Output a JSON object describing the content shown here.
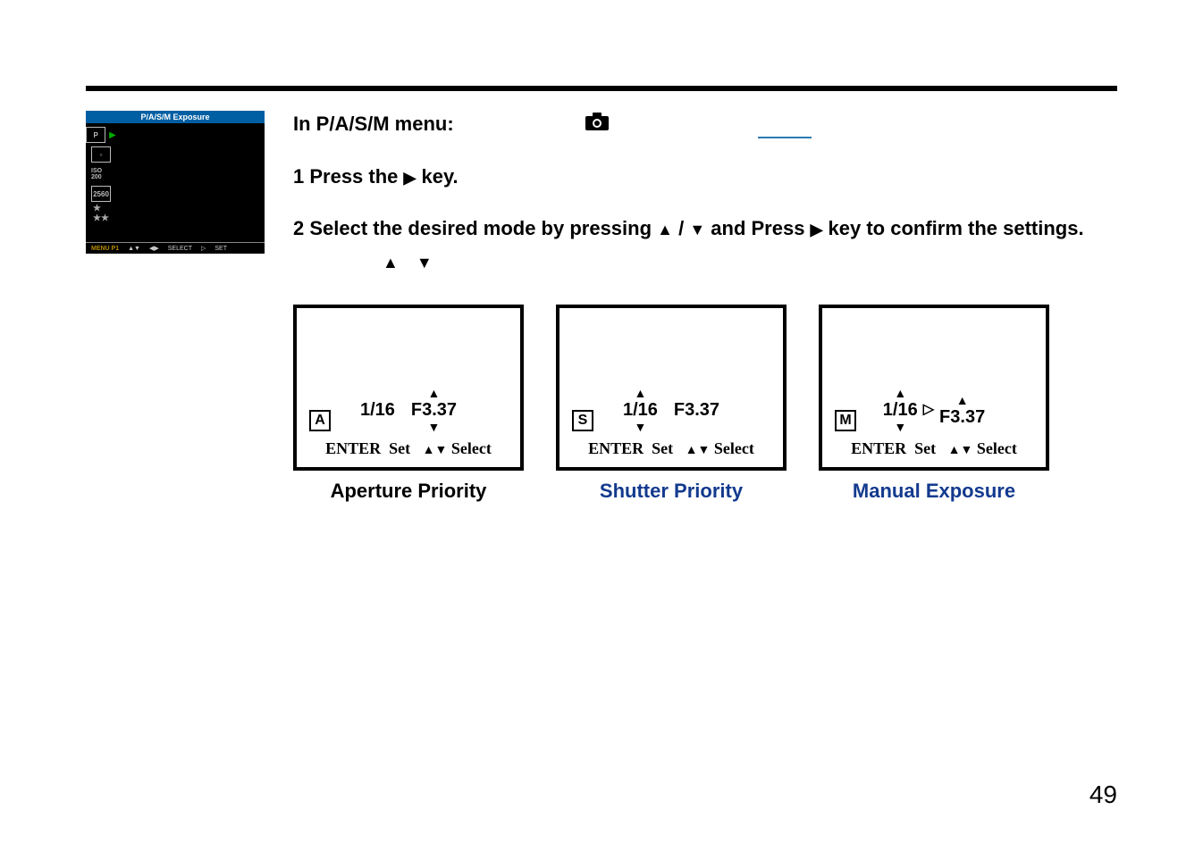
{
  "camera_menu": {
    "title": "P/A/S/M Exposure",
    "icons": {
      "p": "P",
      "iso": "ISO\n200",
      "size": "2560"
    },
    "footer": {
      "menu": "MENU P1",
      "select": "SELECT",
      "set": "SET"
    }
  },
  "instructions": {
    "heading": "In P/A/S/M menu:",
    "step1_prefix": "1 Press the ",
    "step1_suffix": " key.",
    "step2_prefix": "2 Select the desired mode by pressing ",
    "step2_mid": " and Press ",
    "step2_suffix": " key to confirm the settings."
  },
  "exposure": {
    "shutter": "1/16",
    "aperture": "F3.37"
  },
  "hint": {
    "enter": "ENTER",
    "set": "Set",
    "select": "Select"
  },
  "modes": {
    "a": {
      "letter": "A",
      "label": "Aperture Priority"
    },
    "s": {
      "letter": "S",
      "label": "Shutter Priority"
    },
    "m": {
      "letter": "M",
      "label": "Manual Exposure"
    }
  },
  "page_number": "49"
}
